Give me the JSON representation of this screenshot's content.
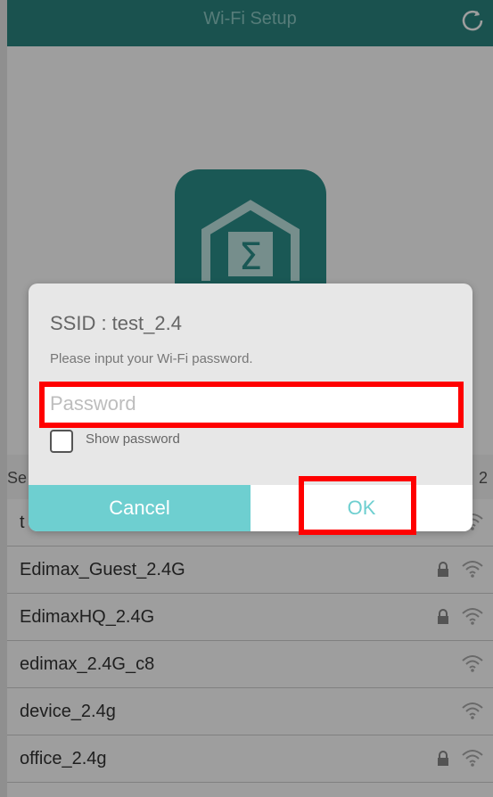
{
  "header": {
    "title": "Wi-Fi Setup",
    "refresh_icon": "refresh-icon"
  },
  "section": {
    "left_text": "Se",
    "right_text": "2"
  },
  "wifi_list": [
    {
      "ssid": "t",
      "locked": false
    },
    {
      "ssid": "Edimax_Guest_2.4G",
      "locked": true
    },
    {
      "ssid": "EdimaxHQ_2.4G",
      "locked": true
    },
    {
      "ssid": "edimax_2.4G_c8",
      "locked": false
    },
    {
      "ssid": "device_2.4g",
      "locked": false
    },
    {
      "ssid": "office_2.4g",
      "locked": true
    }
  ],
  "dialog": {
    "ssid_label": "SSID : test_2.4",
    "hint": "Please input your Wi-Fi password.",
    "password_placeholder": "Password",
    "password_value": "",
    "show_password_label": "Show password",
    "show_password_checked": false,
    "cancel_label": "Cancel",
    "ok_label": "OK"
  },
  "colors": {
    "header_bg": "#2a8580",
    "accent": "#6ecfd0",
    "highlight": "#ff0000"
  }
}
